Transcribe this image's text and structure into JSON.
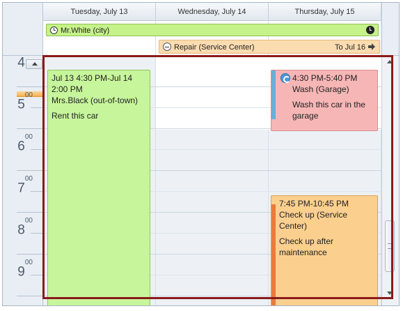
{
  "header": {
    "days": [
      "Tuesday, July 13",
      "Wednesday, July 14",
      "Thursday, July 15"
    ]
  },
  "all_day": {
    "events": [
      {
        "label": "Mr.White (city)",
        "icon": "clock-icon",
        "end_icon": "clock-filled-icon",
        "color": "#c6f28a"
      },
      {
        "label": "Repair (Service Center)",
        "continues_label": "To Jul 16",
        "icon": "minus-circle-icon",
        "end_icon": "arrow-right-icon",
        "color": "#fbdcb0"
      }
    ]
  },
  "ruler": {
    "hours": [
      {
        "hour": "4",
        "minutes": "00"
      },
      {
        "hour": "5",
        "minutes": "00"
      },
      {
        "hour": "6",
        "minutes": "00"
      },
      {
        "hour": "7",
        "minutes": "00"
      },
      {
        "hour": "8",
        "minutes": "00"
      },
      {
        "hour": "9",
        "minutes": "00"
      }
    ]
  },
  "appointments": [
    {
      "time": "Jul 13 4:30 PM-Jul 14",
      "time2": "2:00 PM",
      "subject": "Mrs.Black (out-of-town)",
      "description": "Rent this car",
      "color": "#c7f59b"
    },
    {
      "time": "4:30 PM-5:40 PM",
      "subject": "Wash (Garage)",
      "description": "Wash this car in the garage",
      "icon": "recurrence-icon",
      "color": "#f7b6b6",
      "status_color": "#6aaed6"
    },
    {
      "time": "7:45 PM-10:45 PM",
      "subject": "Check up (Service Center)",
      "description": "Check up after maintenance",
      "color": "#fbcf8e",
      "status_color": "#ec7b3a"
    }
  ],
  "colors": {
    "selection_border": "#8b1a1a",
    "current_time_marker": "#f5b34f"
  }
}
